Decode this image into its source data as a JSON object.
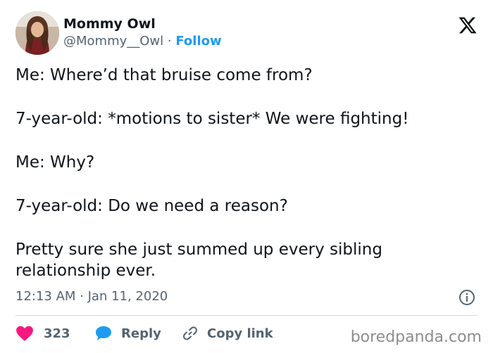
{
  "author": {
    "display_name": "Mommy Owl",
    "handle": "@Mommy__Owl",
    "separator": "·",
    "follow_label": "Follow"
  },
  "tweet": {
    "paragraphs": [
      "Me: Where’d that bruise come from?",
      "7-year-old: *motions to sister* We were fighting!",
      "Me: Why?",
      "7-year-old: Do we need a reason?",
      "Pretty sure she just summed up every sibling relationship ever."
    ],
    "time": "12:13 AM · Jan 11, 2020"
  },
  "actions": {
    "likes": "323",
    "reply_label": "Reply",
    "copy_label": "Copy link"
  },
  "watermark": "boredpanda.com",
  "icons": {
    "x_logo": "x-logo-icon",
    "info": "info-icon",
    "heart": "heart-icon",
    "reply": "speech-bubble-icon",
    "link": "link-icon"
  },
  "colors": {
    "link_blue": "#1d9bf0",
    "like_red": "#f91880",
    "text": "#0f1419",
    "muted": "#536471"
  }
}
